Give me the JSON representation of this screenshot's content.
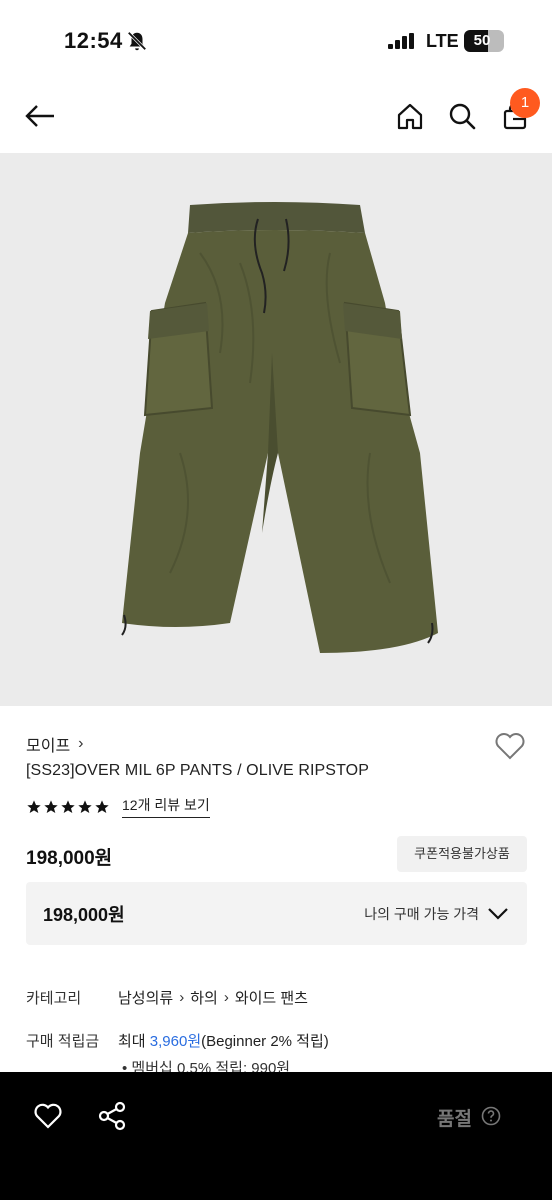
{
  "status": {
    "time": "12:54",
    "network": "LTE",
    "battery": "50"
  },
  "header": {
    "cart_count": "1"
  },
  "product": {
    "brand": "모이프",
    "title": "[SS23]OVER MIL 6P PANTS / OLIVE RIPSTOP",
    "rating_stars": 5,
    "review_link": "12개 리뷰 보기",
    "price": "198,000원",
    "coupon_badge": "쿠폰적용불가상품",
    "my_price_value": "198,000원",
    "my_price_label": "나의 구매 가능 가격",
    "colors": {
      "background": "#ebebeb",
      "pants": "#5a5e3a",
      "badge": "#ff5a1f",
      "points": "#2a6de0"
    }
  },
  "details": {
    "category_label": "카테고리",
    "category_path": [
      "남성의류",
      "하의",
      "와이드 팬츠"
    ],
    "points_label": "구매 적립금",
    "points_prefix": "최대",
    "points_value": "3,960원",
    "points_suffix": "(Beginner 2% 적립)",
    "points_bullet": "멤버십 0.5% 적립: 990원"
  },
  "bottom_bar": {
    "status_label": "품절"
  }
}
